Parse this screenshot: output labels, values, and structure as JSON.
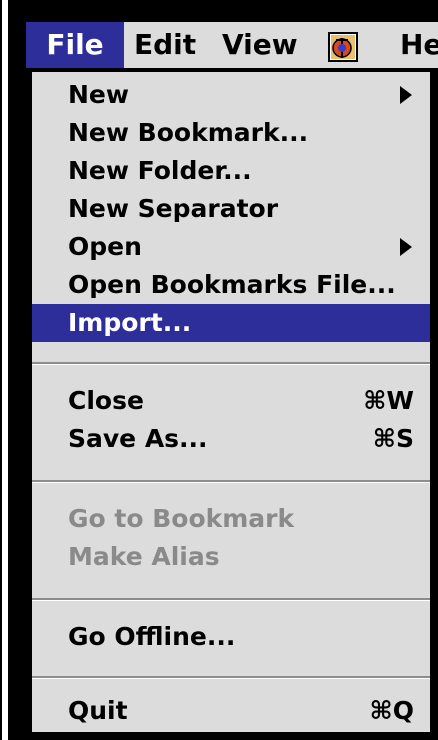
{
  "menubar": {
    "items": [
      {
        "label": "File"
      },
      {
        "label": "Edit"
      },
      {
        "label": "View"
      },
      {
        "label": "He"
      }
    ],
    "app_icon": "netscape-app-icon",
    "active_color": "#2e2e9a"
  },
  "menu": {
    "items": [
      {
        "label": "New",
        "submenu": true
      },
      {
        "label": "New Bookmark..."
      },
      {
        "label": "New Folder..."
      },
      {
        "label": "New Separator"
      },
      {
        "label": "Open",
        "submenu": true
      },
      {
        "label": "Open Bookmarks File..."
      },
      {
        "label": "Import...",
        "highlighted": true
      },
      {
        "label": "Close",
        "shortcut": "⌘W"
      },
      {
        "label": "Save As...",
        "shortcut": "⌘S"
      },
      {
        "label": "Go to Bookmark",
        "disabled": true
      },
      {
        "label": "Make Alias",
        "disabled": true
      },
      {
        "label": "Go Offline..."
      },
      {
        "label": "Quit",
        "shortcut": "⌘Q"
      }
    ]
  }
}
